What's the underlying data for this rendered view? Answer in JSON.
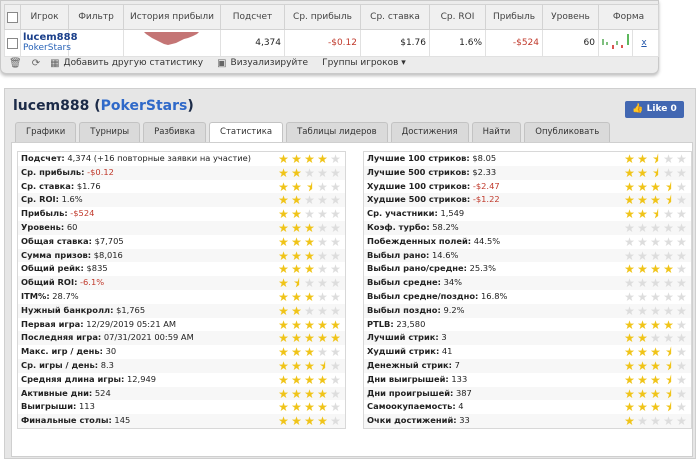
{
  "grid": {
    "headers": [
      "Игрок",
      "Фильтр",
      "История прибыли",
      "Подсчет",
      "Ср. прибыль",
      "Ср. ставка",
      "Ср. ROI",
      "Прибыль",
      "Уровень",
      "Форма"
    ],
    "row": {
      "player_name": "lucem888",
      "player_site": "PokerStars",
      "count": "4,374",
      "avg_profit": "-$0.12",
      "avg_stake": "$1.76",
      "avg_roi": "1.6%",
      "profit": "-$524",
      "level": "60",
      "remove": "x"
    }
  },
  "toolbar": {
    "add_stat": "Добавить другую статистику",
    "visualize": "Визуализируйте",
    "player_groups": "Группы игроков"
  },
  "profile": {
    "name": "lucem888",
    "site": "PokerStars",
    "like": "Like 0",
    "tabs": [
      "Графики",
      "Турниры",
      "Разбивка",
      "Статистика",
      "Таблицы лидеров",
      "Достижения",
      "Найти",
      "Опубликовать"
    ],
    "active_tab": "Статистика"
  },
  "stats_left": [
    {
      "label": "Подсчет:",
      "value": "4,374 (+16 повторные заявки на участие)",
      "stars": 4,
      "neg": false
    },
    {
      "label": "Ср. прибыль:",
      "value": "-$0.12",
      "stars": 2,
      "neg": true
    },
    {
      "label": "Ср. ставка:",
      "value": "$1.76",
      "stars": 2.5,
      "neg": false
    },
    {
      "label": "Ср. ROI:",
      "value": "1.6%",
      "stars": 2,
      "neg": false
    },
    {
      "label": "Прибыль:",
      "value": "-$524",
      "stars": 2,
      "neg": true
    },
    {
      "label": "Уровень:",
      "value": "60",
      "stars": 3,
      "neg": false
    },
    {
      "label": "Общая ставка:",
      "value": "$7,705",
      "stars": 3,
      "neg": false
    },
    {
      "label": "Сумма призов:",
      "value": "$8,016",
      "stars": 3,
      "neg": false
    },
    {
      "label": "Общий рейк:",
      "value": "$835",
      "stars": 3,
      "neg": false
    },
    {
      "label": "Общий ROI:",
      "value": "-6.1%",
      "stars": 1.5,
      "neg": true
    },
    {
      "label": "ITM%:",
      "value": "28.7%",
      "stars": 3,
      "neg": false
    },
    {
      "label": "Нужный банкролл:",
      "value": "$1,765",
      "stars": 2,
      "neg": false
    },
    {
      "label": "Первая игра:",
      "value": "12/29/2019 05:21 AM",
      "stars": 5,
      "neg": false
    },
    {
      "label": "Последняя игра:",
      "value": "07/31/2021 00:59 AM",
      "stars": 5,
      "neg": false
    },
    {
      "label": "Макс. игр / день:",
      "value": "30",
      "stars": 3,
      "neg": false
    },
    {
      "label": "Ср. игры / день:",
      "value": "8.3",
      "stars": 3.5,
      "neg": false
    },
    {
      "label": "Средняя длина игры:",
      "value": "12,949",
      "stars": 4,
      "neg": false
    },
    {
      "label": "Активные дни:",
      "value": "524",
      "stars": 4,
      "neg": false
    },
    {
      "label": "Выигрыши:",
      "value": "113",
      "stars": 4,
      "neg": false
    },
    {
      "label": "Финальные столы:",
      "value": "145",
      "stars": 4,
      "neg": false
    }
  ],
  "stats_right": [
    {
      "label": "Лучшие 100 стриков:",
      "value": "$8.05",
      "stars": 2.5,
      "neg": false
    },
    {
      "label": "Лучшие 500 стриков:",
      "value": "$2.33",
      "stars": 2.5,
      "neg": false
    },
    {
      "label": "Худшие 100 стриков:",
      "value": "-$2.47",
      "stars": 3.5,
      "neg": true
    },
    {
      "label": "Худшие 500 стриков:",
      "value": "-$1.22",
      "stars": 3.5,
      "neg": true
    },
    {
      "label": "Ср. участники:",
      "value": "1,549",
      "stars": 2.5,
      "neg": false
    },
    {
      "label": "Коэф. турбо:",
      "value": "58.2%",
      "stars": 0,
      "neg": false
    },
    {
      "label": "Побежденных полей:",
      "value": "44.5%",
      "stars": 0,
      "neg": false
    },
    {
      "label": "Выбыл рано:",
      "value": "14.6%",
      "stars": 0,
      "neg": false
    },
    {
      "label": "Выбыл рано/средне:",
      "value": "25.3%",
      "stars": 4,
      "neg": false
    },
    {
      "label": "Выбыл средне:",
      "value": "34%",
      "stars": 0,
      "neg": false
    },
    {
      "label": "Выбыл средне/поздно:",
      "value": "16.8%",
      "stars": 0,
      "neg": false
    },
    {
      "label": "Выбыл поздно:",
      "value": "9.2%",
      "stars": 0,
      "neg": false
    },
    {
      "label": "PTLB:",
      "value": "23,580",
      "stars": 4,
      "neg": false
    },
    {
      "label": "Лучший стрик:",
      "value": "3",
      "stars": 2,
      "neg": false
    },
    {
      "label": "Худший стрик:",
      "value": "41",
      "stars": 3.5,
      "neg": false
    },
    {
      "label": "Денежный стрик:",
      "value": "7",
      "stars": 3.5,
      "neg": false
    },
    {
      "label": "Дни выигрышей:",
      "value": "133",
      "stars": 3.5,
      "neg": false
    },
    {
      "label": "Дни проигрышей:",
      "value": "387",
      "stars": 3.5,
      "neg": false
    },
    {
      "label": "Самоокупаемость:",
      "value": "4",
      "stars": 3.5,
      "neg": false
    },
    {
      "label": "Очки достижений:",
      "value": "33",
      "stars": 1,
      "neg": false
    }
  ]
}
